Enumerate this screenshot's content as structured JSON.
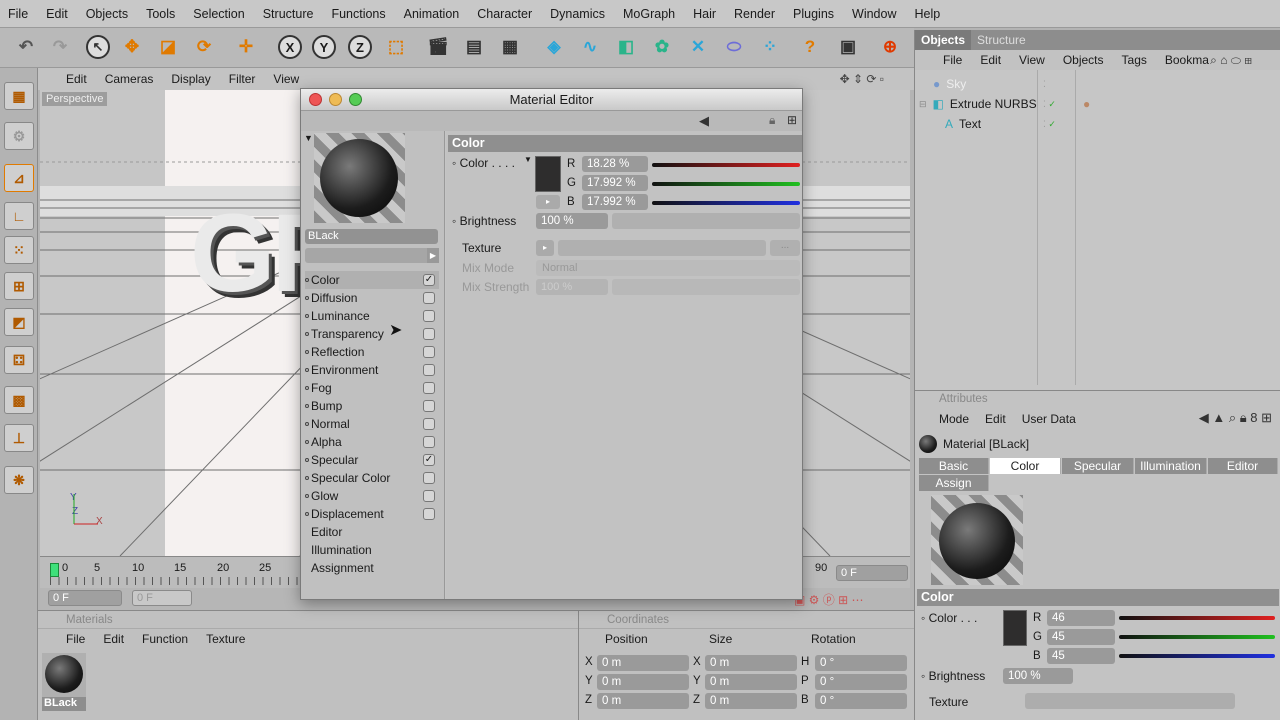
{
  "menubar": [
    "File",
    "Edit",
    "Objects",
    "Tools",
    "Selection",
    "Structure",
    "Functions",
    "Animation",
    "Character",
    "Dynamics",
    "MoGraph",
    "Hair",
    "Render",
    "Plugins",
    "Window",
    "Help"
  ],
  "viewport": {
    "menu": [
      "Edit",
      "Cameras",
      "Display",
      "Filter",
      "View"
    ],
    "label": "Perspective",
    "text3d": "GF",
    "axes": {
      "y": "Y",
      "z": "Z",
      "x": "X"
    }
  },
  "timeline": {
    "ticks": [
      "0",
      "5",
      "10",
      "15",
      "20",
      "25"
    ],
    "end_tick": "90",
    "start_frame": "0 F",
    "ghost_frame": "0 F",
    "end_frame": "0 F"
  },
  "objects_panel": {
    "tabs": [
      "Objects",
      "Structure"
    ],
    "menu": [
      "File",
      "Edit",
      "View",
      "Objects",
      "Tags",
      "Bookma"
    ],
    "items": [
      "Sky",
      "Extrude NURBS",
      "Text"
    ]
  },
  "attributes": {
    "header": "Attributes",
    "menu": [
      "Mode",
      "Edit",
      "User Data"
    ],
    "title": "Material [BLack]",
    "tabs": [
      "Basic",
      "Color",
      "Specular",
      "Illumination",
      "Editor",
      "Assign"
    ],
    "section": "Color",
    "color_label": "Color",
    "r_label": "R",
    "g_label": "G",
    "b_label": "B",
    "r": "46",
    "g": "45",
    "b": "45",
    "brightness_label": "Brightness",
    "brightness": "100 %",
    "texture_label": "Texture"
  },
  "materials_panel": {
    "header": "Materials",
    "menu": [
      "File",
      "Edit",
      "Function",
      "Texture"
    ],
    "material_name": "BLack"
  },
  "coordinates": {
    "header": "Coordinates",
    "cols": [
      "Position",
      "Size",
      "Rotation"
    ],
    "rows": [
      {
        "a": "X",
        "av": "0 m",
        "b": "X",
        "bv": "0 m",
        "c": "H",
        "cv": "0 °"
      },
      {
        "a": "Y",
        "av": "0 m",
        "b": "Y",
        "bv": "0 m",
        "c": "P",
        "cv": "0 °"
      },
      {
        "a": "Z",
        "av": "0 m",
        "b": "Z",
        "bv": "0 m",
        "c": "B",
        "cv": "0 °"
      }
    ]
  },
  "material_editor": {
    "title": "Material Editor",
    "name": "BLack",
    "channels": [
      {
        "label": "Color",
        "checked": "✓"
      },
      {
        "label": "Diffusion",
        "checked": ""
      },
      {
        "label": "Luminance",
        "checked": ""
      },
      {
        "label": "Transparency",
        "checked": ""
      },
      {
        "label": "Reflection",
        "checked": ""
      },
      {
        "label": "Environment",
        "checked": ""
      },
      {
        "label": "Fog",
        "checked": ""
      },
      {
        "label": "Bump",
        "checked": ""
      },
      {
        "label": "Normal",
        "checked": ""
      },
      {
        "label": "Alpha",
        "checked": ""
      },
      {
        "label": "Specular",
        "checked": "✓"
      },
      {
        "label": "Specular Color",
        "checked": ""
      },
      {
        "label": "Glow",
        "checked": ""
      },
      {
        "label": "Displacement",
        "checked": ""
      }
    ],
    "extra": [
      "Editor",
      "Illumination",
      "Assignment"
    ],
    "section": "Color",
    "color_label": "Color",
    "r_label": "R",
    "g_label": "G",
    "b_label": "B",
    "r": "18.28 %",
    "g": "17.992 %",
    "b": "17.992 %",
    "brightness_label": "Brightness",
    "brightness": "100 %",
    "texture_label": "Texture",
    "mix_mode_label": "Mix Mode",
    "mix_mode": "Normal",
    "mix_strength_label": "Mix Strength",
    "mix_strength": "100 %",
    "swatch_color": "#2e2d2d"
  },
  "colors": {
    "accent": "#ff7a00",
    "red": "#e02020",
    "green": "#20c020",
    "blue": "#2030e0"
  }
}
